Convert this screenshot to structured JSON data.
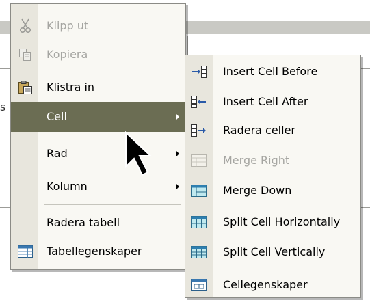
{
  "main_menu": {
    "items": [
      {
        "label": "Klipp ut",
        "icon": "scissors-icon",
        "disabled": true
      },
      {
        "label": "Kopiera",
        "icon": "copy-icon",
        "disabled": true
      },
      {
        "label": "Klistra in",
        "icon": "clipboard-icon",
        "disabled": false
      },
      {
        "label": "Cell",
        "submenu": true,
        "highlighted": true
      },
      {
        "label": "Rad",
        "submenu": true
      },
      {
        "label": "Kolumn",
        "submenu": true
      },
      {
        "label": "Radera tabell"
      },
      {
        "label": "Tabellegenskaper",
        "icon": "table-properties-icon"
      }
    ]
  },
  "sub_menu": {
    "items": [
      {
        "label": "Insert Cell Before",
        "icon": "insert-cell-before-icon"
      },
      {
        "label": "Insert Cell After",
        "icon": "insert-cell-after-icon"
      },
      {
        "label": "Radera celler",
        "icon": "delete-cells-icon"
      },
      {
        "label": "Merge Right",
        "icon": "merge-right-icon",
        "disabled": true
      },
      {
        "label": "Merge Down",
        "icon": "merge-down-icon"
      },
      {
        "label": "Split Cell Horizontally",
        "icon": "split-horizontal-icon"
      },
      {
        "label": "Split Cell Vertically",
        "icon": "split-vertical-icon"
      },
      {
        "label": "Cellegenskaper",
        "icon": "cell-properties-icon"
      }
    ]
  },
  "background": {
    "fragment_text": "s"
  },
  "colors": {
    "highlight": "#6b6d53",
    "menu_bg": "#f9f8f3",
    "gutter": "#e8e6dd",
    "disabled_text": "#a6a6a2"
  }
}
